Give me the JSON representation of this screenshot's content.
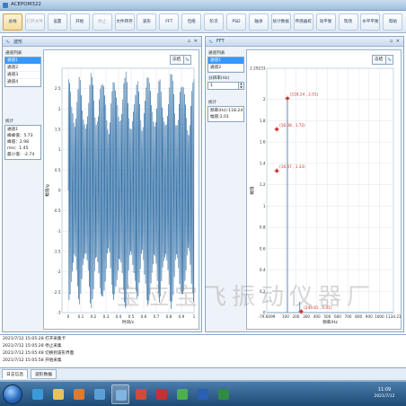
{
  "app": {
    "title": "ACEPOM322"
  },
  "toolbar": {
    "buttons": [
      {
        "label": "总线",
        "state": "active"
      },
      {
        "label": "打开文件",
        "state": "disabled"
      },
      {
        "label": "设置",
        "state": "normal"
      },
      {
        "label": "开始",
        "state": "normal"
      },
      {
        "label": "停止",
        "state": "disabled"
      },
      {
        "label": "文件转存",
        "state": "normal"
      },
      {
        "label": "波形",
        "state": "normal"
      },
      {
        "label": "FFT",
        "state": "normal"
      },
      {
        "label": "包络",
        "state": "normal"
      },
      {
        "label": "阶次",
        "state": "normal"
      },
      {
        "label": "PSD",
        "state": "normal"
      },
      {
        "label": "轴承",
        "state": "normal"
      },
      {
        "label": "统计数据",
        "state": "normal"
      },
      {
        "label": "传感器校",
        "state": "normal"
      },
      {
        "label": "动平衡",
        "state": "normal"
      },
      {
        "label": "现场",
        "state": "normal"
      },
      {
        "label": "水平平衡",
        "state": "normal"
      },
      {
        "label": "帮助",
        "state": "normal"
      }
    ]
  },
  "wave_panel": {
    "title": "波形",
    "channel_list_label": "通道列表",
    "channels": [
      "通道1",
      "通道2",
      "通道3",
      "通道4"
    ],
    "stats_label": "统计",
    "stats": [
      "通道1",
      "峰峰值：5.73",
      "峰值：2.98",
      "rms：1.45",
      "最小值：-2.74"
    ],
    "freeze_label": "冻结",
    "freeze_icon": "wave-icon"
  },
  "fft_panel": {
    "title": "FFT",
    "channel_list_label": "通道列表",
    "channels": [
      "通道1",
      "通道2"
    ],
    "resolution_label": "分辨率(Hz)",
    "resolution_value": "1",
    "stats_label": "统计",
    "stats": [
      "频率(Hz):118.24",
      "幅值:2.01"
    ],
    "freeze_label": "冻结",
    "freeze_icon": "wave-icon"
  },
  "watermark": "宝应宝飞振动仪器厂",
  "log": {
    "lines": [
      "2021/7/12 15:05:28 打开采集卡",
      "2021/7/12 15:05:28 停止采集",
      "2021/7/12 15:05:48 切换到波形界面",
      "2021/7/12 15:05:58 开始采集"
    ],
    "tabs": [
      "日志信息",
      "波形数据"
    ]
  },
  "taskbar": {
    "time": "11:09",
    "date": "2021/7/12",
    "items": [
      {
        "icon": "ie-icon",
        "color": "#3a9ad9",
        "active": false
      },
      {
        "icon": "folder-icon",
        "color": "#e8c25a",
        "active": false
      },
      {
        "icon": "media-player-icon",
        "color": "#e07a2e",
        "active": false
      },
      {
        "icon": "network-icon",
        "color": "#5aa0d6",
        "active": false
      },
      {
        "icon": "app-icon",
        "color": "#7fb3e0",
        "active": true
      },
      {
        "icon": "shield-icon",
        "color": "#d24a3a",
        "active": false
      },
      {
        "icon": "pdf-icon",
        "color": "#c73030",
        "active": false
      },
      {
        "icon": "chrome-icon",
        "color": "#4caf50",
        "active": false
      },
      {
        "icon": "word-icon",
        "color": "#2b5fb3",
        "active": false
      },
      {
        "icon": "excel-icon",
        "color": "#2e8b48",
        "active": false
      }
    ]
  },
  "chart_data": [
    {
      "type": "line",
      "title": "",
      "xlabel": "时间/s",
      "ylabel": "幅值/g",
      "xlim": [
        -0.05,
        1.0
      ],
      "ylim": [
        -3.0,
        3.0
      ],
      "x_ticks": [
        0,
        0.1,
        0.2,
        0.3,
        0.4,
        0.5,
        0.6,
        0.7,
        0.8,
        0.9,
        1
      ],
      "y_ticks": [
        -3,
        -2.5,
        -2,
        -1.5,
        -1,
        -0.5,
        0,
        0.5,
        1,
        1.5,
        2,
        2.5
      ],
      "grid": true,
      "series": [
        {
          "dominant_frequency_hz": 118.24,
          "x_range": [
            0,
            1.0
          ],
          "peak": 2.98,
          "min": -2.74,
          "rms": 1.45
        }
      ]
    },
    {
      "type": "line",
      "title": "",
      "xlabel": "频率/Hz",
      "ylabel": "幅值",
      "xlim": [
        -79.6099,
        1134.21
      ],
      "ylim": [
        0,
        2.29233
      ],
      "x_ticks": [
        "-79.6099",
        "100",
        "200",
        "300",
        "400",
        "500",
        "600",
        "700",
        "800",
        "900",
        "1000",
        "1134.21"
      ],
      "y_ticks": [
        "0",
        "0.2",
        "0.4",
        "0.6",
        "0.8",
        "1",
        "1.2",
        "1.4",
        "1.6",
        "1.8",
        "2",
        "2.29233"
      ],
      "grid": true,
      "peaks": [
        {
          "x": 118.24,
          "y": 2.01
        },
        {
          "x": 236.48,
          "y": 0.1
        }
      ],
      "markers": [
        {
          "label": "(118.24 , 2.01)",
          "x": 118.24,
          "y": 2.01
        },
        {
          "label": "(16.08 , 1.72)",
          "x": 16.08,
          "y": 1.72
        },
        {
          "label": "(16.67 , 1.33)",
          "x": 16.67,
          "y": 1.33
        },
        {
          "label": "(249.81 , 0.01)",
          "x": 249.81,
          "y": 0.01
        }
      ]
    }
  ]
}
